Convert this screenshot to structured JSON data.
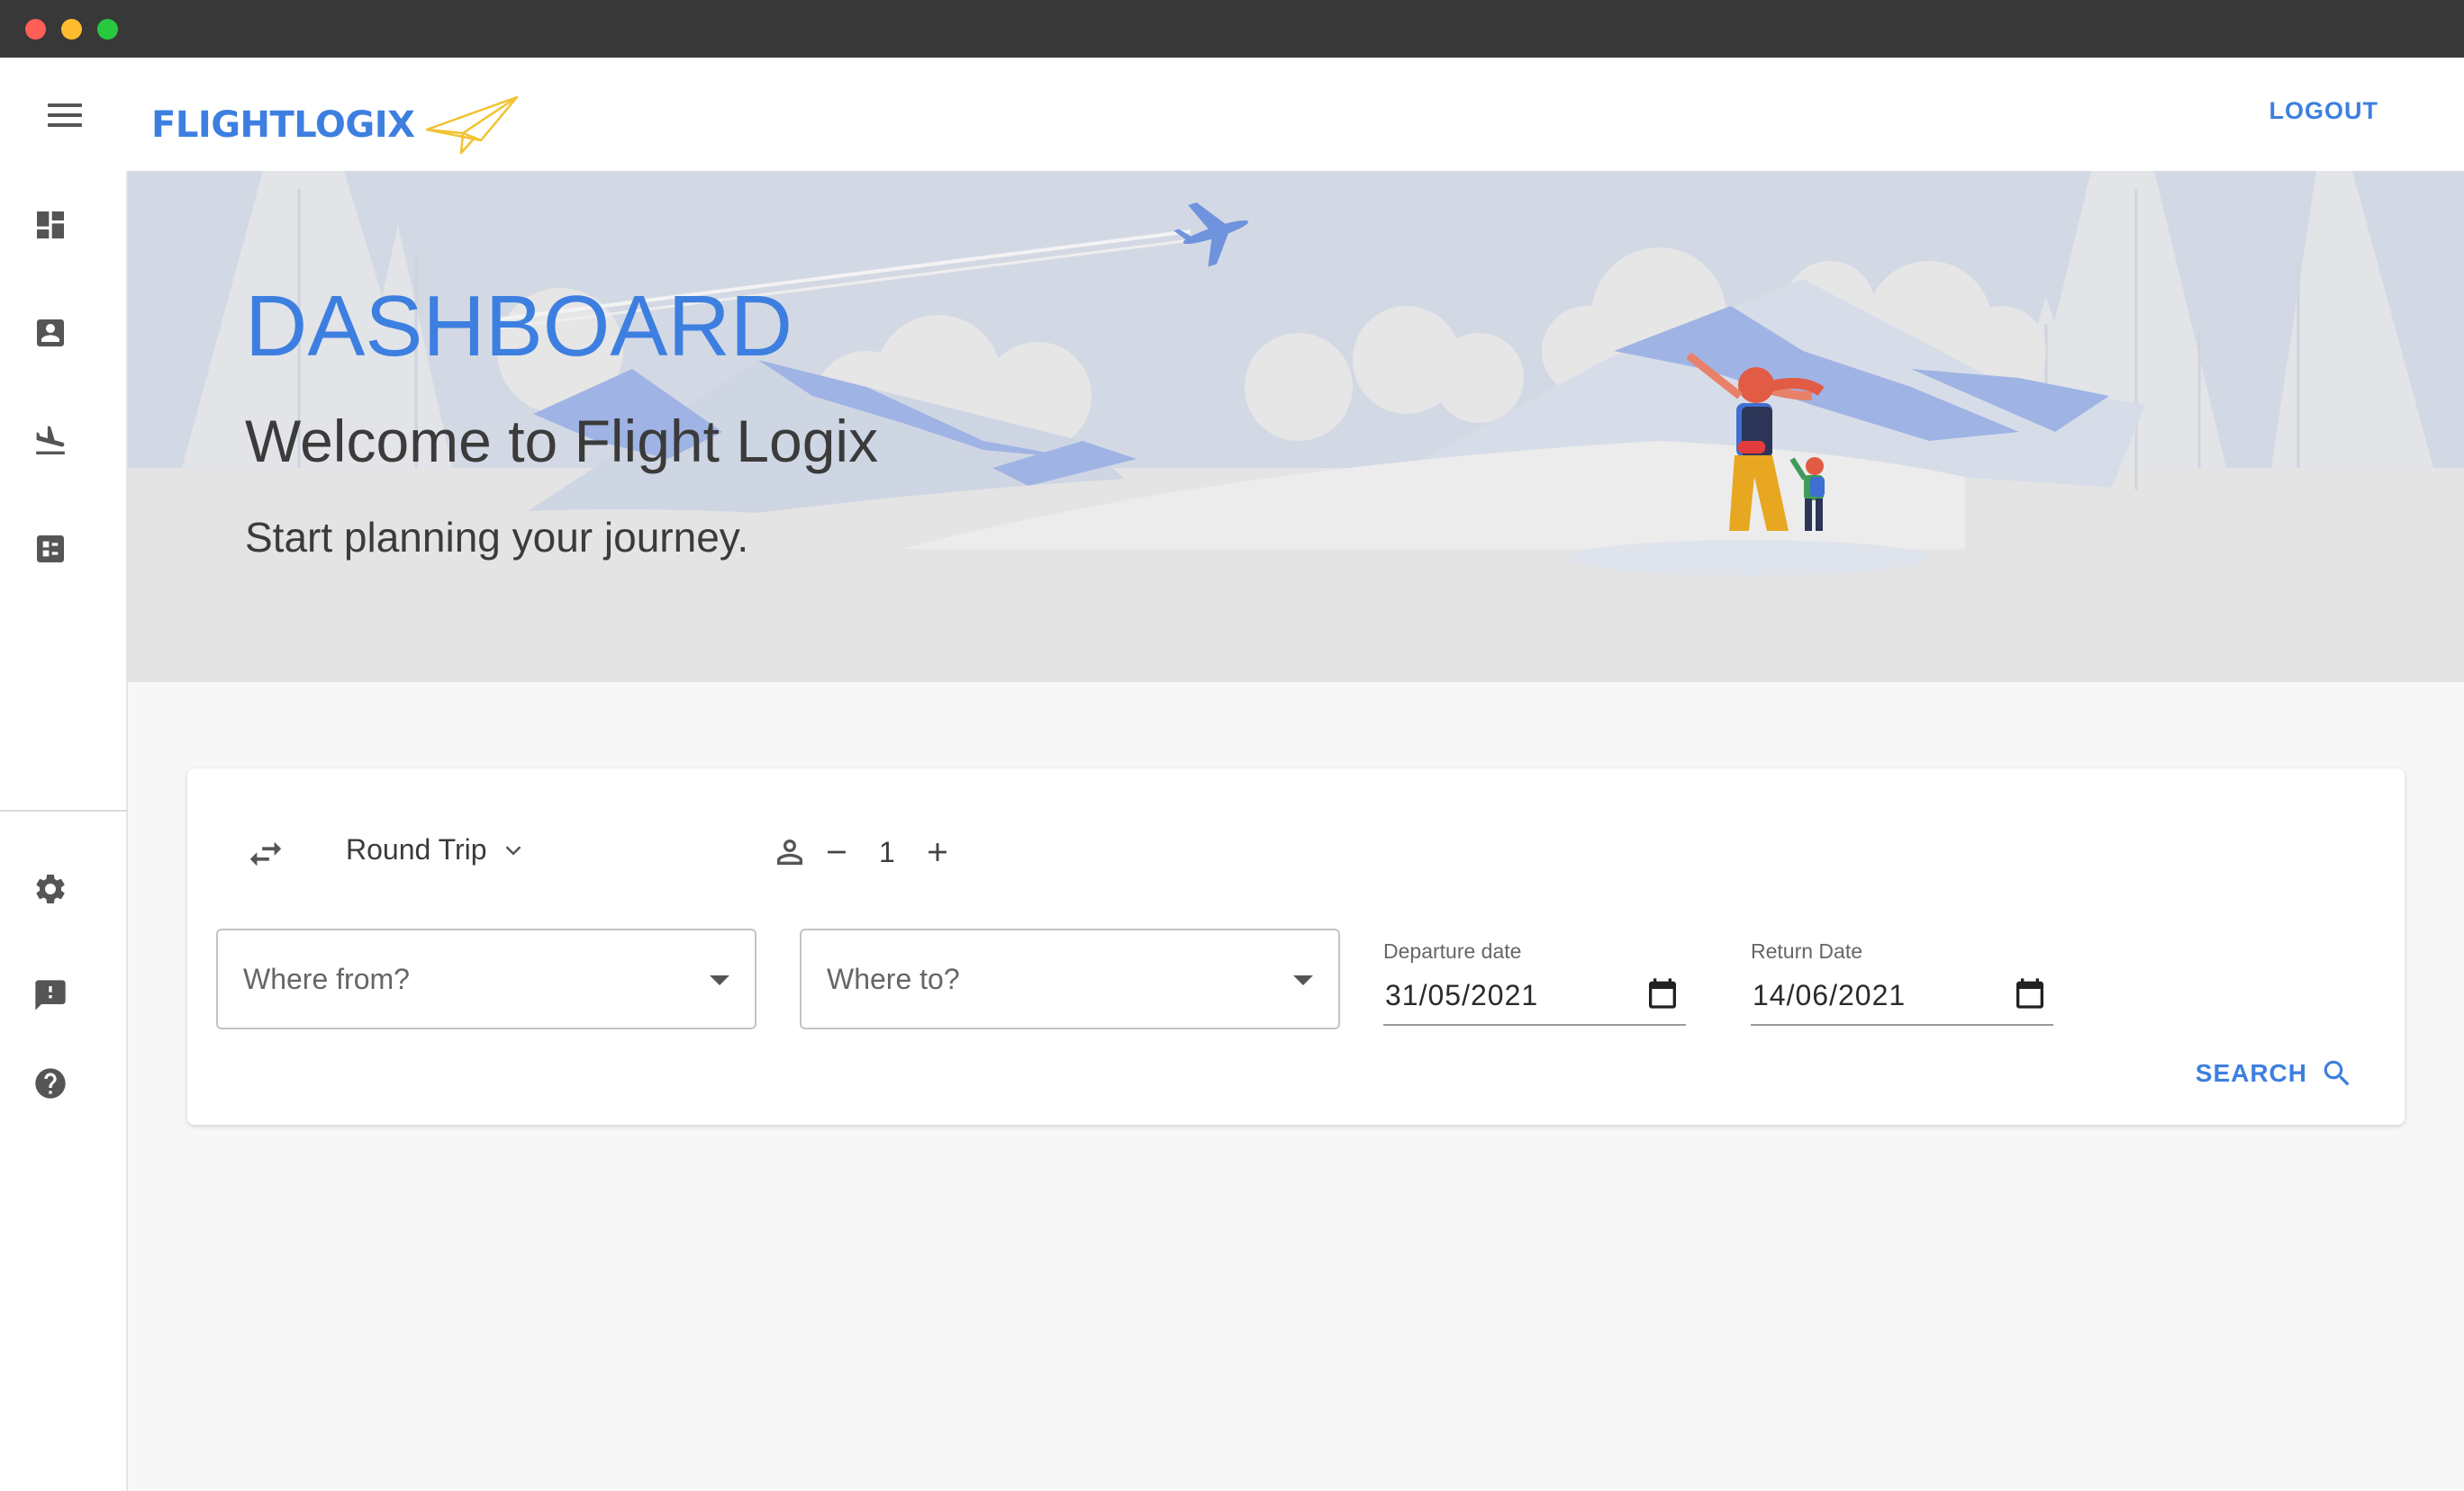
{
  "app": {
    "brand": "FLIGHTLOGIX",
    "logout_label": "LOGOUT"
  },
  "sidebar": {
    "items": [
      {
        "icon": "dashboard-icon"
      },
      {
        "icon": "contact-card-icon"
      },
      {
        "icon": "flight-land-icon"
      },
      {
        "icon": "list-alt-icon"
      }
    ],
    "bottom_items": [
      {
        "icon": "gear-icon"
      },
      {
        "icon": "feedback-icon"
      },
      {
        "icon": "help-icon"
      }
    ]
  },
  "banner": {
    "title": "DASHBOARD",
    "welcome": "Welcome to Flight Logix",
    "subtitle": "Start planning your journey."
  },
  "search": {
    "trip_type": "Round Trip",
    "passengers": "1",
    "from_placeholder": "Where from?",
    "to_placeholder": "Where to?",
    "departure_label": "Departure date",
    "departure_value": "31/05/2021",
    "return_label": "Return Date",
    "return_value": "14/06/2021",
    "search_label": "SEARCH"
  },
  "colors": {
    "accent": "#3d7fe0",
    "banner_bg": "#e4e4e4",
    "page_bg": "#f7f7f7",
    "logo_plane": "#f2c230"
  }
}
